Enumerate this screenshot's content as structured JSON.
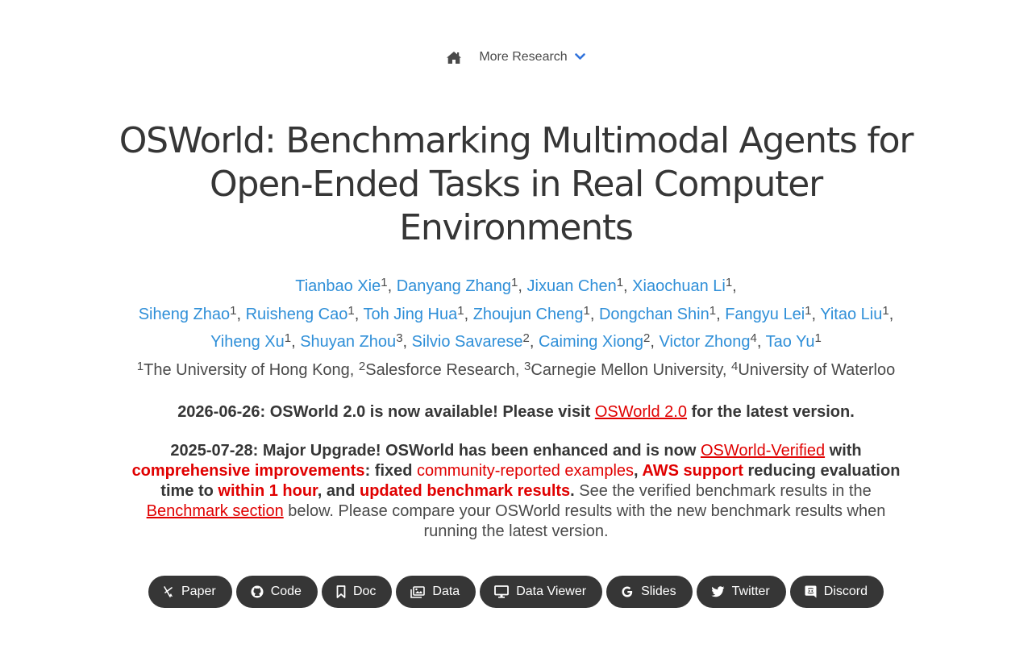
{
  "nav": {
    "home_icon": "home-icon",
    "more_label": "More Research",
    "chevron_icon": "chevron-down-icon",
    "accent_color": "#3273dc"
  },
  "title": "OSWorld: Benchmarking Multimodal Agents for Open-Ended Tasks in Real Computer Environments",
  "authors": [
    {
      "name": "Tianbao Xie",
      "aff": "1"
    },
    {
      "name": "Danyang Zhang",
      "aff": "1"
    },
    {
      "name": "Jixuan Chen",
      "aff": "1"
    },
    {
      "name": "Xiaochuan Li",
      "aff": "1"
    },
    {
      "name": "Siheng Zhao",
      "aff": "1"
    },
    {
      "name": "Ruisheng Cao",
      "aff": "1"
    },
    {
      "name": "Toh Jing Hua",
      "aff": "1"
    },
    {
      "name": "Zhoujun Cheng",
      "aff": "1"
    },
    {
      "name": "Dongchan Shin",
      "aff": "1"
    },
    {
      "name": "Fangyu Lei",
      "aff": "1"
    },
    {
      "name": "Yitao Liu",
      "aff": "1"
    },
    {
      "name": "Yiheng Xu",
      "aff": "1"
    },
    {
      "name": "Shuyan Zhou",
      "aff": "3"
    },
    {
      "name": "Silvio Savarese",
      "aff": "2"
    },
    {
      "name": "Caiming Xiong",
      "aff": "2"
    },
    {
      "name": "Victor Zhong",
      "aff": "4"
    },
    {
      "name": "Tao Yu",
      "aff": "1"
    }
  ],
  "affiliations": [
    {
      "num": "1",
      "name": "The University of Hong Kong"
    },
    {
      "num": "2",
      "name": "Salesforce Research"
    },
    {
      "num": "3",
      "name": "Carnegie Mellon University"
    },
    {
      "num": "4",
      "name": "University of Waterloo"
    }
  ],
  "news1": {
    "prefix": "2026-06-26: OSWorld 2.0 is now available! Please visit ",
    "link": "OSWorld 2.0",
    "suffix": " for the latest version."
  },
  "news2": {
    "t1": "2025-07-28: Major Upgrade! OSWorld has been enhanced and is now ",
    "link1": "OSWorld-Verified",
    "t2": " with ",
    "r1": "comprehensive improvements",
    "t3": ": fixed ",
    "r2": "community-reported examples",
    "t4": ", ",
    "r3": "AWS support",
    "t5": " reducing evaluation time to ",
    "r4": "within 1 hour",
    "t6": ", and ",
    "r5": "updated benchmark results",
    "t7": ".",
    "t8": " See the verified benchmark results in the ",
    "link2": "Benchmark section",
    "t9": " below. Please compare your OSWorld results with the new benchmark results when running the latest version."
  },
  "buttons": [
    {
      "label": "Paper",
      "icon": "paper-icon"
    },
    {
      "label": "Code",
      "icon": "github-icon"
    },
    {
      "label": "Doc",
      "icon": "bookmark-icon"
    },
    {
      "label": "Data",
      "icon": "images-icon"
    },
    {
      "label": "Data Viewer",
      "icon": "monitor-icon"
    },
    {
      "label": "Slides",
      "icon": "google-icon"
    },
    {
      "label": "Twitter",
      "icon": "twitter-icon"
    },
    {
      "label": "Discord",
      "icon": "discord-icon"
    }
  ],
  "colors": {
    "link_blue": "#2f8fd8",
    "highlight_red": "#e00000",
    "button_bg": "#363636",
    "text_dark": "#363636"
  }
}
